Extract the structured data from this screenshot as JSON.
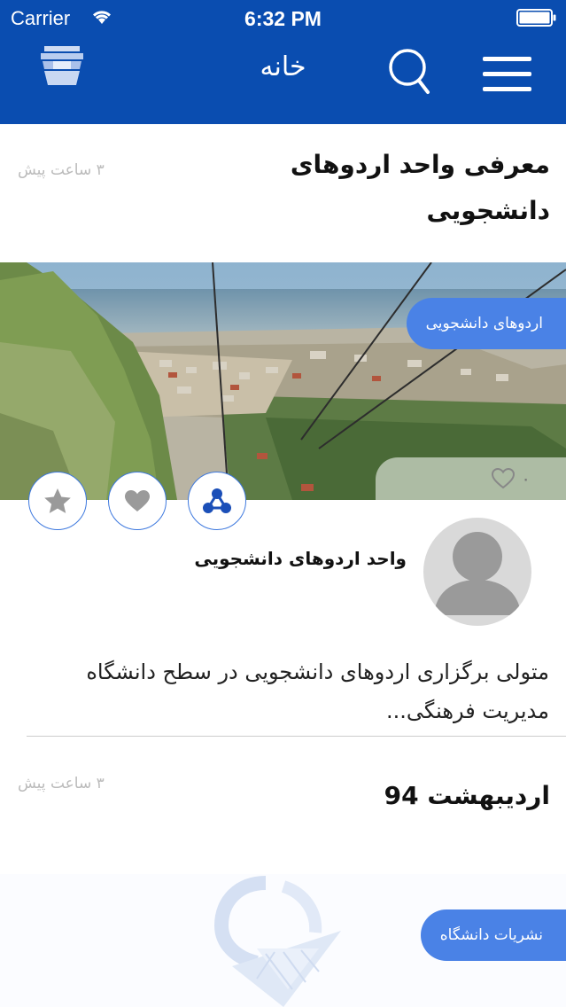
{
  "status_bar": {
    "carrier": "Carrier",
    "time": "6:32 PM"
  },
  "nav": {
    "title": "خانه",
    "color": "#0a4db0"
  },
  "posts": [
    {
      "title": "معرفی واحد اردوهای دانشجویی",
      "time": "۳ ساعت پیش",
      "category": "اردوهای دانشجویی",
      "likes": "۰",
      "author": "واحد اردوهای دانشجویی",
      "excerpt": "متولی برگزاری اردوهای دانشجویی در سطح دانشگاه مدیریت فرهنگی..."
    },
    {
      "title": "اردیبهشت 94",
      "time": "۳ ساعت پیش",
      "category": "نشریات دانشگاه"
    }
  ],
  "accent_color": "#4a82e6"
}
